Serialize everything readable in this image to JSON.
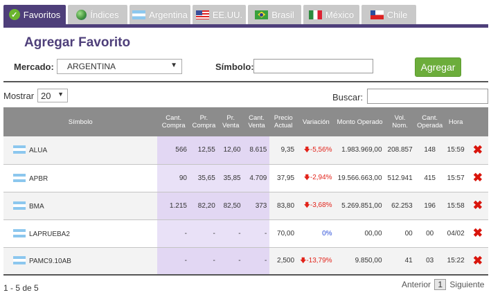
{
  "tabs": [
    {
      "label": "Favoritos",
      "icon": "check-icon",
      "active": true
    },
    {
      "label": "Índices",
      "icon": "globe-icon",
      "active": false
    },
    {
      "label": "Argentina",
      "icon": "flag-argentina-icon",
      "active": false
    },
    {
      "label": "EE.UU.",
      "icon": "flag-usa-icon",
      "active": false
    },
    {
      "label": "Brasil",
      "icon": "flag-brazil-icon",
      "active": false
    },
    {
      "label": "México",
      "icon": "flag-mexico-icon",
      "active": false
    },
    {
      "label": "Chile",
      "icon": "flag-chile-icon",
      "active": false
    }
  ],
  "colors": {
    "accent": "#4e3f7a",
    "button": "#6cad3b",
    "negative": "#e2231a",
    "positive": "#2b4fd8",
    "highlight": "#e9e1f7"
  },
  "form": {
    "title": "Agregar Favorito",
    "market_label": "Mercado:",
    "market_value": "ARGENTINA",
    "symbol_label": "Símbolo:",
    "symbol_value": "",
    "add_button": "Agregar"
  },
  "controls": {
    "show_label": "Mostrar",
    "page_size": "20",
    "search_label": "Buscar:",
    "search_value": ""
  },
  "table": {
    "headers": [
      "Símbolo",
      "Cant. Compra",
      "Pr. Compra",
      "Pr. Venta",
      "Cant. Venta",
      "Precio Actual",
      "Variación",
      "Monto Operado",
      "Vol. Nom.",
      "Cant. Operada",
      "Hora"
    ],
    "rows": [
      {
        "symbol": "ALUA",
        "cant_compra": "566",
        "pr_compra": "12,55",
        "pr_venta": "12,60",
        "cant_venta": "8.615",
        "precio": "9,35",
        "variacion": "-5,56%",
        "trend": "down",
        "monto": "1.983.969,00",
        "vol": "208.857",
        "cant_op": "148",
        "hora": "15:59"
      },
      {
        "symbol": "APBR",
        "cant_compra": "90",
        "pr_compra": "35,65",
        "pr_venta": "35,85",
        "cant_venta": "4.709",
        "precio": "37,95",
        "variacion": "-2,94%",
        "trend": "down",
        "monto": "19.566.663,00",
        "vol": "512.941",
        "cant_op": "415",
        "hora": "15:57"
      },
      {
        "symbol": "BMA",
        "cant_compra": "1.215",
        "pr_compra": "82,20",
        "pr_venta": "82,50",
        "cant_venta": "373",
        "precio": "83,80",
        "variacion": "-3,68%",
        "trend": "down",
        "monto": "5.269.851,00",
        "vol": "62.253",
        "cant_op": "196",
        "hora": "15:58"
      },
      {
        "symbol": "LAPRUEBA2",
        "cant_compra": "-",
        "pr_compra": "-",
        "pr_venta": "-",
        "cant_venta": "-",
        "precio": "70,00",
        "variacion": "0%",
        "trend": "flat",
        "monto": "00,00",
        "vol": "00",
        "cant_op": "00",
        "hora": "04/02"
      },
      {
        "symbol": "PAMC9.10AB",
        "cant_compra": "-",
        "pr_compra": "-",
        "pr_venta": "-",
        "cant_venta": "-",
        "precio": "2,500",
        "variacion": "-13,79%",
        "trend": "down",
        "monto": "9.850,00",
        "vol": "41",
        "cant_op": "03",
        "hora": "15:22"
      }
    ]
  },
  "pagination": {
    "info": "1 - 5 de 5",
    "prev": "Anterior",
    "page": "1",
    "next": "Siguiente"
  }
}
